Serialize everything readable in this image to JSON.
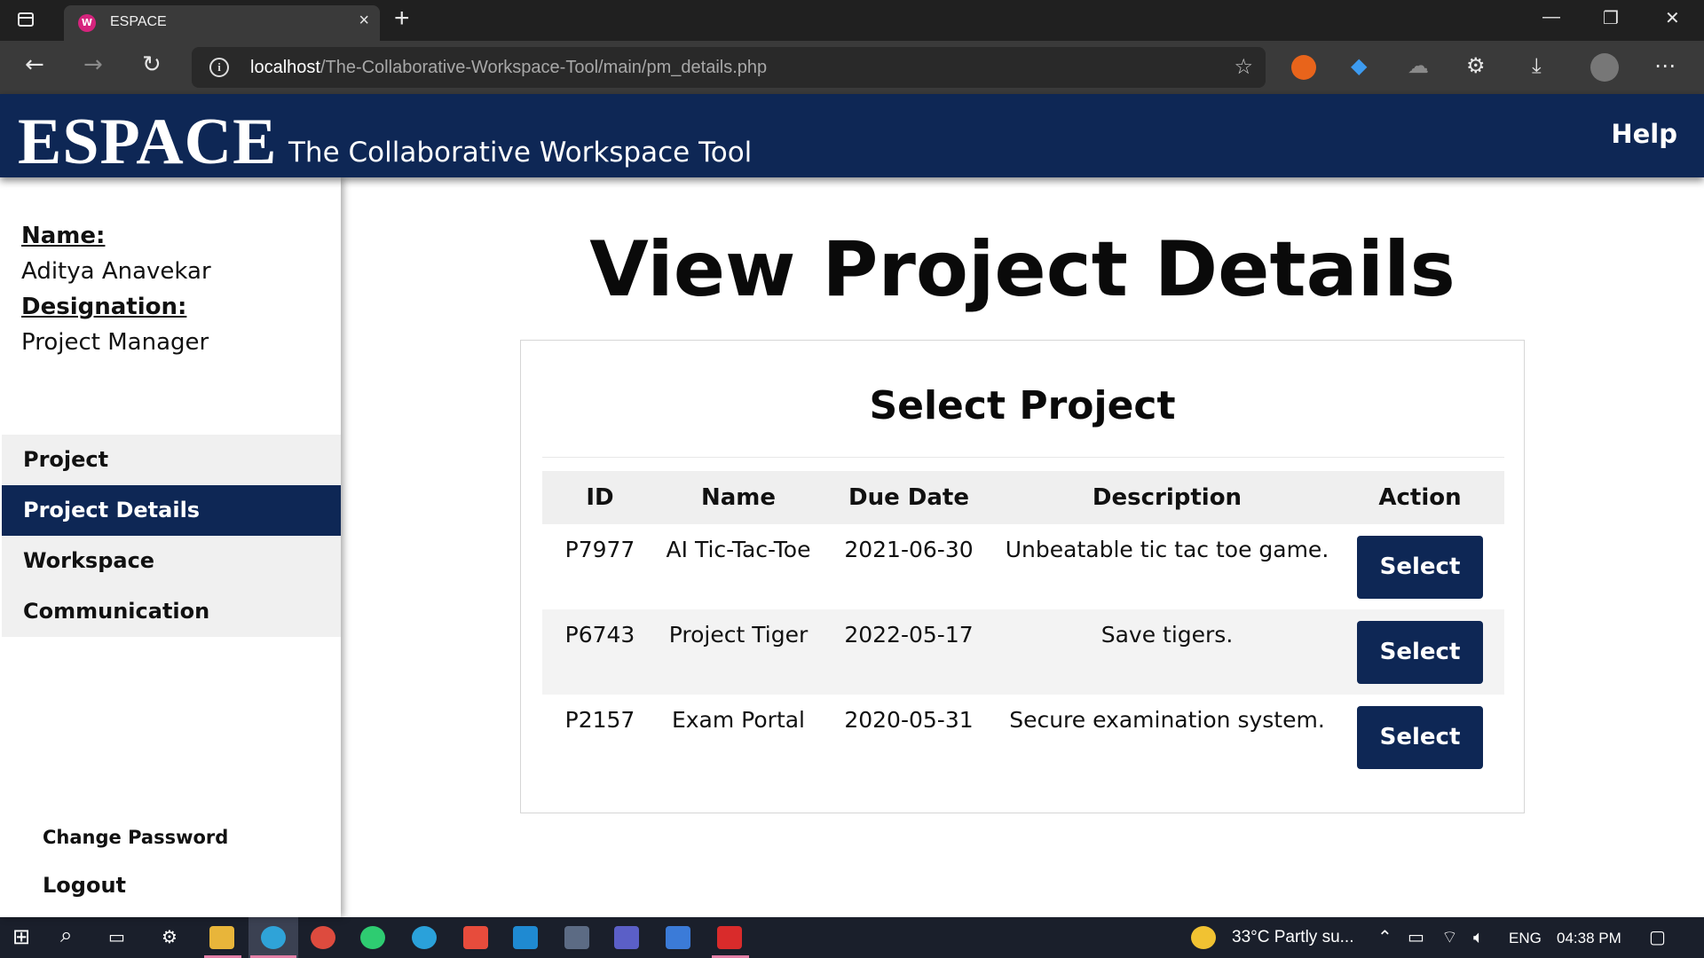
{
  "browser": {
    "tab_title": "ESPACE",
    "tab_close": "×",
    "new_tab": "+",
    "url_host": "localhost",
    "url_path": "/The-Collaborative-Workspace-Tool/main/pm_details.php",
    "win_minimize": "—",
    "win_restore": "❐",
    "win_close": "✕"
  },
  "header": {
    "brand": "ESPACE",
    "tagline": "The Collaborative Workspace Tool",
    "help": "Help"
  },
  "profile": {
    "name_label": "Name:",
    "name_value": "Aditya Anavekar",
    "designation_label": "Designation:",
    "designation_value": "Project Manager"
  },
  "menu": {
    "items": [
      {
        "label": "Project"
      },
      {
        "label": "Project Details"
      },
      {
        "label": "Workspace"
      },
      {
        "label": "Communication"
      }
    ],
    "active_index": 1
  },
  "account": {
    "change_password": "Change Password",
    "logout": "Logout"
  },
  "main": {
    "title": "View Project Details",
    "card_title": "Select Project",
    "columns": [
      "ID",
      "Name",
      "Due Date",
      "Description",
      "Action"
    ],
    "rows": [
      {
        "id": "P7977",
        "name": "AI Tic-Tac-Toe",
        "due": "2021-06-30",
        "description": "Unbeatable tic tac toe game.",
        "action": "Select"
      },
      {
        "id": "P6743",
        "name": "Project Tiger",
        "due": "2022-05-17",
        "description": "Save tigers.",
        "action": "Select"
      },
      {
        "id": "P2157",
        "name": "Exam Portal",
        "due": "2020-05-31",
        "description": "Secure examination system.",
        "action": "Select"
      }
    ]
  },
  "taskbar": {
    "weather": "33°C  Partly su...",
    "language": "ENG",
    "time": "04:38 PM"
  },
  "colors": {
    "navy": "#0e2755",
    "chrome_dark": "#202020",
    "chrome_toolbar": "#3a3a3a",
    "taskbar": "#1a1f2b"
  }
}
